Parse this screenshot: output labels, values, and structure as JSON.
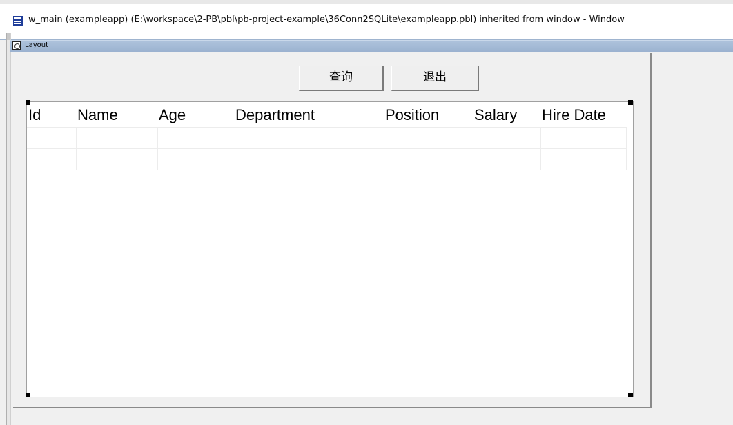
{
  "window": {
    "title": "w_main (exampleapp) (E:\\workspace\\2-PB\\pbl\\pb-project-example\\36Conn2SQLite\\exampleapp.pbl) inherited from window - Window"
  },
  "layout_bar": {
    "label": "Layout",
    "icon": "layout-icon"
  },
  "buttons": {
    "query_label": "查询",
    "exit_label": "退出"
  },
  "grid": {
    "columns": [
      "Id",
      "Name",
      "Age",
      "Department",
      "Position",
      "Salary",
      "Hire Date"
    ],
    "rows": [
      [
        "",
        "",
        "",
        "",
        "",
        "",
        ""
      ],
      [
        "",
        "",
        "",
        "",
        "",
        "",
        ""
      ]
    ]
  },
  "colors": {
    "titlebar_bg": "#ffffff",
    "layoutbar_bg": "#9bb2d0",
    "window_bg": "#f0f0f0",
    "grid_bg": "#ffffff"
  }
}
